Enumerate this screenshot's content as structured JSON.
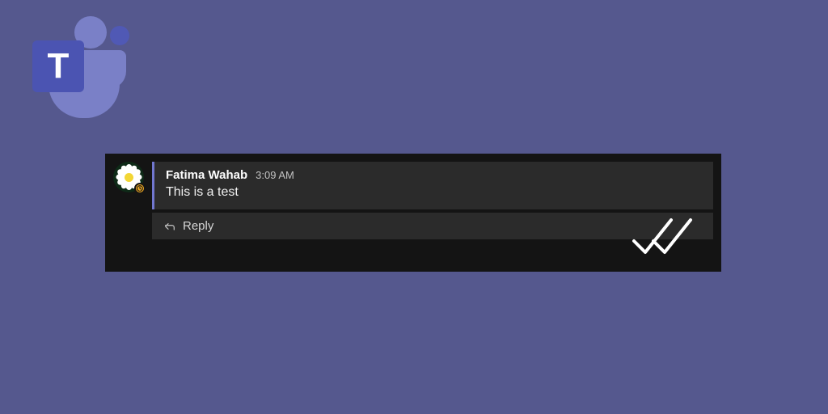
{
  "logo": {
    "letter": "T"
  },
  "message": {
    "author": "Fatima Wahab",
    "time": "3:09 AM",
    "text": "This is a test",
    "reply_label": "Reply",
    "presence": "away"
  },
  "colors": {
    "page_bg": "#55588e",
    "card_bg": "#141414",
    "bubble_bg": "#2b2b2b",
    "accent": "#7177cf"
  }
}
